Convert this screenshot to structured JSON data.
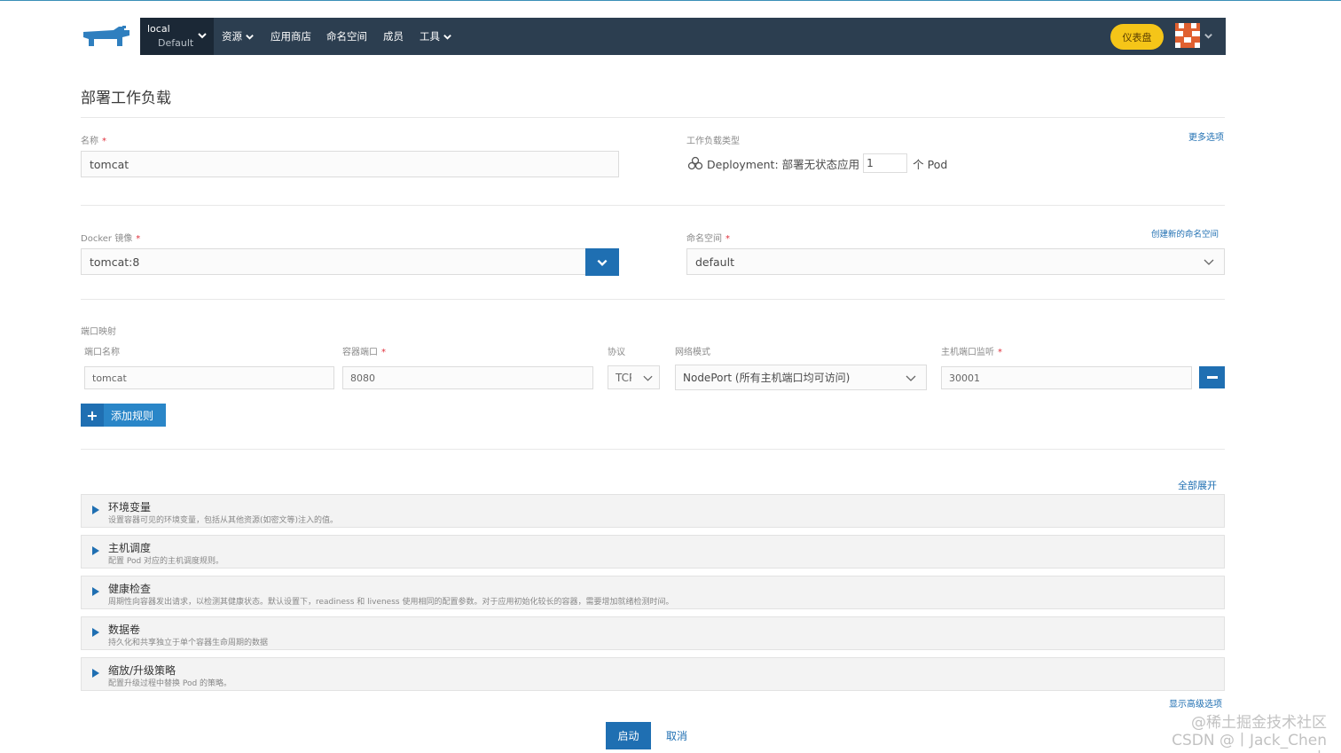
{
  "header": {
    "cluster_name": "local",
    "project_name": "Default",
    "nav": [
      {
        "label": "资源",
        "dropdown": true
      },
      {
        "label": "应用商店",
        "dropdown": false
      },
      {
        "label": "命名空间",
        "dropdown": false
      },
      {
        "label": "成员",
        "dropdown": false
      },
      {
        "label": "工具",
        "dropdown": true
      }
    ],
    "dashboard_label": "仪表盘"
  },
  "page_title": "部署工作负载",
  "name_field": {
    "label": "名称",
    "value": "tomcat"
  },
  "workload_type": {
    "label": "工作负载类型",
    "more_options": "更多选项",
    "type_text": "Deployment: 部署无状态应用",
    "replicas": "1",
    "unit": "个 Pod"
  },
  "docker_image": {
    "label": "Docker 镜像",
    "value": "tomcat:8"
  },
  "namespace": {
    "label": "命名空间",
    "create_link": "创建新的命名空间",
    "value": "default"
  },
  "port_mapping": {
    "section_label": "端口映射",
    "columns": {
      "port_name": "端口名称",
      "container_port": "容器端口",
      "protocol": "协议",
      "network_mode": "网络模式",
      "host_port": "主机端口监听"
    },
    "row": {
      "port_name": "tomcat",
      "container_port": "8080",
      "protocol": "TCP",
      "network_mode": "NodePort (所有主机端口均可访问)",
      "host_port": "30001"
    },
    "add_rule_label": "添加规则"
  },
  "expand_all": "全部展开",
  "sections": [
    {
      "title": "环境变量",
      "desc": "设置容器可见的环境变量，包括从其他资源(如密文等)注入的值。"
    },
    {
      "title": "主机调度",
      "desc": "配置 Pod 对应的主机调度规则。"
    },
    {
      "title": "健康检查",
      "desc": "周期性向容器发出请求，以检测其健康状态。默认设置下，readiness 和 liveness 使用相同的配置参数。对于应用初始化较长的容器，需要增加就绪检测时间。"
    },
    {
      "title": "数据卷",
      "desc": "持久化和共享独立于单个容器生命周期的数据"
    },
    {
      "title": "缩放/升级策略",
      "desc": "配置升级过程中替换 Pod 的策略。"
    }
  ],
  "show_advanced": "显示高级选项",
  "footer": {
    "launch": "启动",
    "cancel": "取消"
  },
  "watermark": {
    "line1": "@稀土掘金技术社区",
    "line2": "CSDN @丨Jack_Chen丨"
  },
  "colors": {
    "nav_bg": "#2c3e50",
    "primary": "#1f6fb2",
    "dashboard": "#f5c518",
    "required": "#e0303c"
  }
}
